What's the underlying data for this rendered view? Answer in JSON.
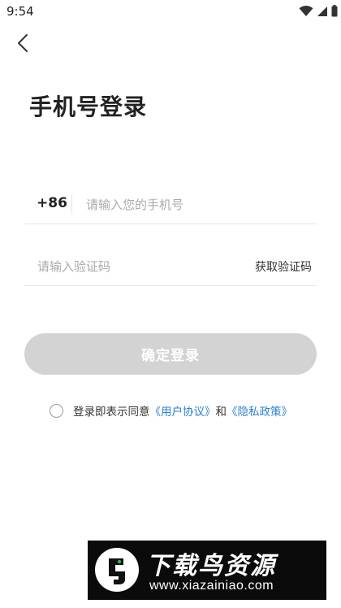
{
  "status_bar": {
    "time": "9:54"
  },
  "nav": {
    "back_icon": "chevron-left-icon"
  },
  "page": {
    "title": "手机号登录"
  },
  "phone": {
    "country_code": "+86",
    "placeholder": "请输入您的手机号",
    "value": ""
  },
  "verification": {
    "placeholder": "请输入验证码",
    "value": "",
    "get_code_label": "获取验证码"
  },
  "login_button": {
    "label": "确定登录",
    "enabled": false,
    "color": "#d3d3d3"
  },
  "agreement": {
    "checked": false,
    "prefix": "登录即表示同意",
    "user_agreement": "《用户协议》",
    "conjunction": "和",
    "privacy_policy": "《隐私政策》",
    "link_color": "#2f80d1"
  },
  "watermark": {
    "title": "下载鸟资源",
    "url": "www.xiazainiao.com"
  }
}
